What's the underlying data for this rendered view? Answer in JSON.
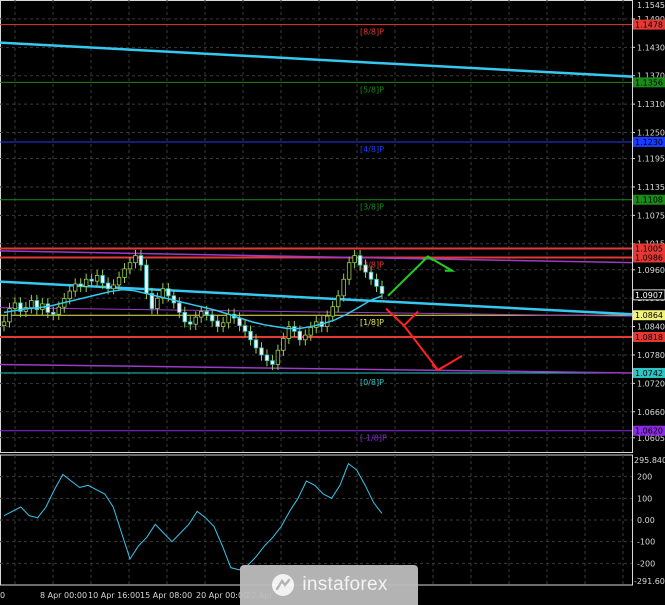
{
  "chart_data": [
    {
      "type": "candlestick",
      "title": "",
      "price_scale": {
        "min": 1.0575,
        "max": 1.153,
        "ticks": [
          "1.1545",
          "1.1490",
          "1.1430",
          "1.1370",
          "1.1310",
          "1.1250",
          "1.1195",
          "1.1135",
          "1.1075",
          "1.1015",
          "1.0960",
          "1.0900",
          "1.0840",
          "1.0780",
          "1.0720",
          "1.0660",
          "1.0605"
        ]
      },
      "time_labels": [
        "0",
        "8 Apr 00:00",
        "10 Apr 16:00",
        "15 Apr 08:00",
        "20 Apr 00:00",
        "22 Apr"
      ],
      "murrey_levels": [
        {
          "label": "[8/8]P",
          "price": 1.1478,
          "color": "#e53935",
          "tag": "1.1478",
          "tag_bg": "#e53935"
        },
        {
          "label": "[5/8]P",
          "price": 1.1356,
          "color": "#1b8a1b",
          "tag": "1.1356",
          "tag_bg": "#1b8a1b"
        },
        {
          "label": "[4/8]P",
          "price": 1.123,
          "color": "#1a3cff",
          "tag": "1.1230",
          "tag_bg": "#1a3cff"
        },
        {
          "label": "[3/8]P",
          "price": 1.1108,
          "color": "#1b8a1b",
          "tag": "1.1108",
          "tag_bg": "#1b8a1b"
        },
        {
          "label": "[2/8]P",
          "price": 1.0986,
          "color": "#e53935",
          "tag": "1.0986",
          "tag_bg": "#e53935"
        },
        {
          "label": "[1/8]P",
          "price": 1.0864,
          "color": "#e8e84a",
          "tag": "1.0864",
          "tag_bg": "#f2f27a"
        },
        {
          "label": "[0/8]P",
          "price": 1.0742,
          "color": "#2ec5c5",
          "tag": "1.0742",
          "tag_bg": "#2ec5c5"
        },
        {
          "label": "[-1/8]P",
          "price": 1.062,
          "color": "#8a2be2",
          "tag": "1.0620",
          "tag_bg": "#8a2be2"
        }
      ],
      "extra_tags": [
        {
          "text": "1.1005",
          "bg": "#e53935",
          "price": 1.1005
        },
        {
          "text": "1.0907",
          "bg": "#000000",
          "price": 1.0907,
          "fg": "#ffffff"
        },
        {
          "text": "1.0818",
          "bg": "#e53935",
          "price": 1.0818
        }
      ],
      "candles_close": [
        1.085,
        1.0878,
        1.089,
        1.0872,
        1.088,
        1.0895,
        1.0876,
        1.0888,
        1.087,
        1.0866,
        1.0881,
        1.0899,
        1.0915,
        1.093,
        1.0925,
        1.094,
        1.0936,
        1.0948,
        1.0932,
        1.092,
        1.0928,
        1.0944,
        1.0962,
        1.0975,
        1.099,
        1.097,
        1.091,
        1.0878,
        1.09,
        1.092,
        1.0905,
        1.089,
        1.087,
        1.085,
        1.0845,
        1.086,
        1.0872,
        1.0865,
        1.0852,
        1.084,
        1.0848,
        1.0866,
        1.0858,
        1.0842,
        1.083,
        1.0812,
        1.0795,
        1.078,
        1.0768,
        1.076,
        1.079,
        1.0815,
        1.084,
        1.083,
        1.0812,
        1.0822,
        1.0838,
        1.085,
        1.084,
        1.0862,
        1.0882,
        1.0905,
        1.094,
        1.0975,
        1.099,
        1.097,
        1.0955,
        1.094,
        1.0925,
        1.091
      ],
      "ma_line": [
        1.087,
        1.0874,
        1.0878,
        1.088,
        1.0884,
        1.089,
        1.0896,
        1.0902,
        1.0908,
        1.0914,
        1.0918,
        1.0916,
        1.091,
        1.0904,
        1.0898,
        1.0892,
        1.0886,
        1.088,
        1.0874,
        1.0866,
        1.0858,
        1.085,
        1.0844,
        1.084,
        1.0836,
        1.0836,
        1.084,
        1.0846,
        1.0854,
        1.0866,
        1.088,
        1.0895,
        1.0905
      ],
      "oscillator": {
        "top_label": "295.8402",
        "bottom_label": "-291.6046",
        "ticks": [
          "200",
          "100",
          "0.00",
          "-100",
          "-200"
        ],
        "values": [
          20,
          40,
          60,
          20,
          10,
          60,
          140,
          210,
          180,
          150,
          160,
          140,
          120,
          60,
          -60,
          -180,
          -120,
          -80,
          -20,
          -60,
          -100,
          -60,
          -20,
          40,
          10,
          -30,
          -120,
          -220,
          -230,
          -210,
          -170,
          -120,
          -80,
          -30,
          40,
          100,
          180,
          160,
          120,
          100,
          160,
          260,
          230,
          160,
          80,
          30
        ]
      }
    }
  ],
  "arrows": [
    {
      "kind": "up-projection",
      "color": "#22cc22"
    },
    {
      "kind": "down-projection",
      "color": "#ff2222"
    }
  ],
  "watermark": {
    "text": "instaforex"
  }
}
